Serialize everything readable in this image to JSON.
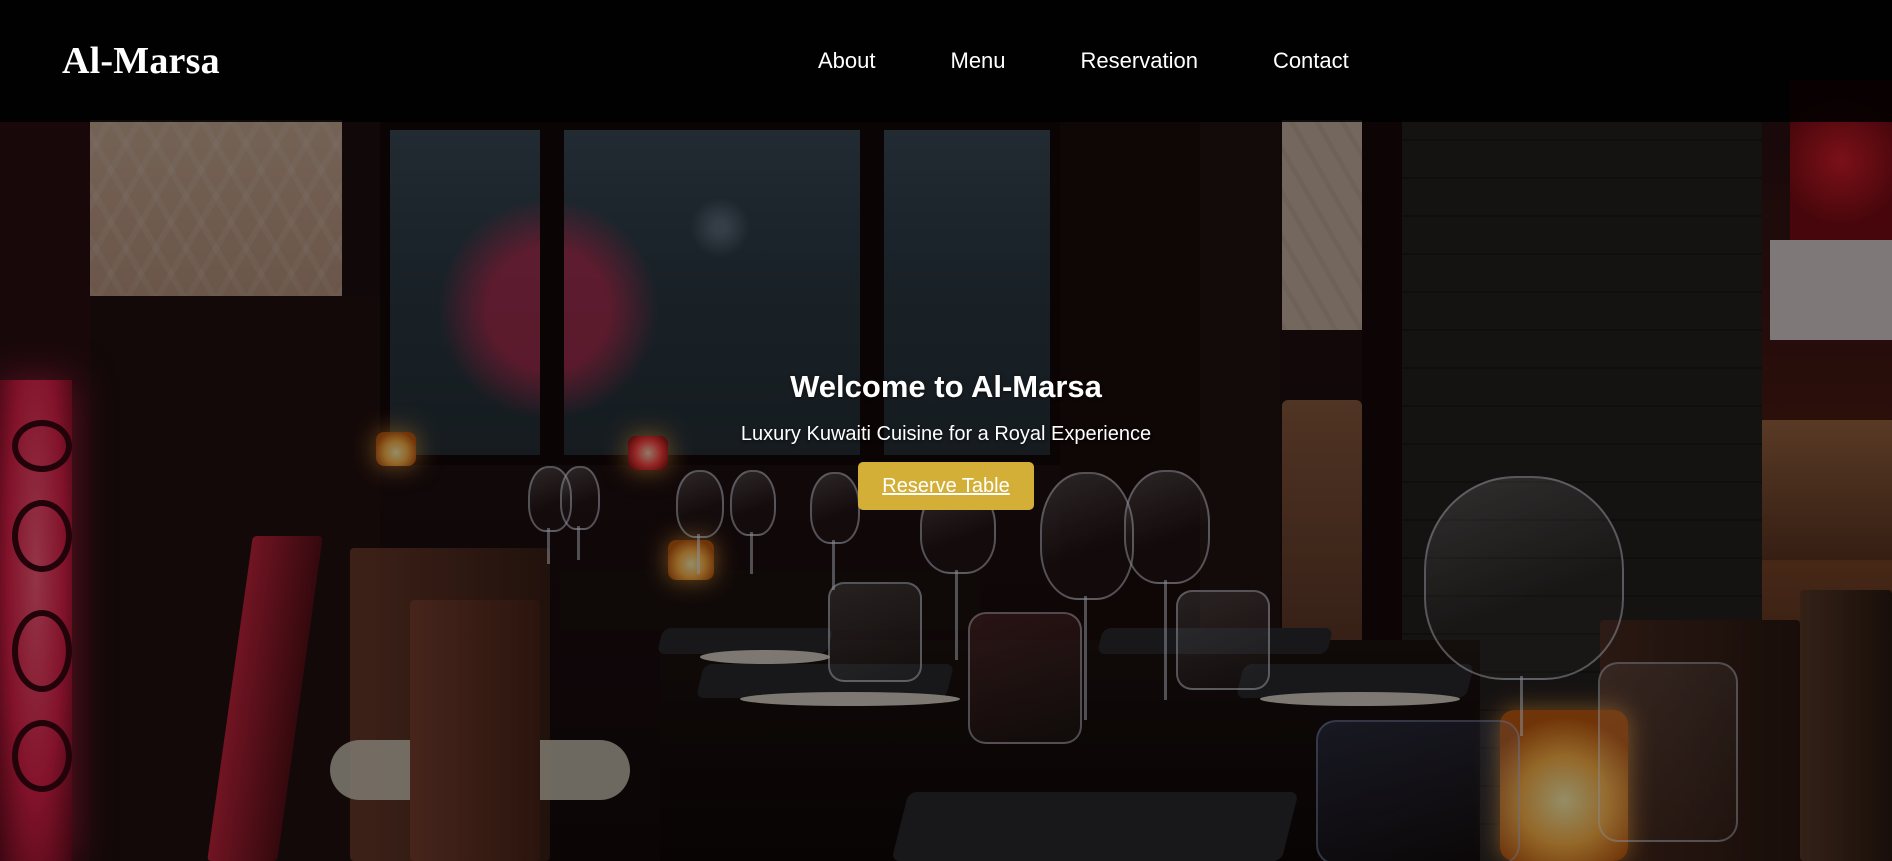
{
  "site": {
    "brand": "Al-Marsa"
  },
  "nav": {
    "items": [
      {
        "label": "About"
      },
      {
        "label": "Menu"
      },
      {
        "label": "Reservation"
      },
      {
        "label": "Contact"
      }
    ]
  },
  "hero": {
    "title": "Welcome to Al-Marsa",
    "subtitle": "Luxury Kuwaiti Cuisine for a Royal Experience",
    "cta_label": "Reserve Table",
    "background": "restaurant-interior-photo"
  },
  "colors": {
    "accent": "#d4af37",
    "navbar_bg": "#000000",
    "text": "#ffffff"
  }
}
